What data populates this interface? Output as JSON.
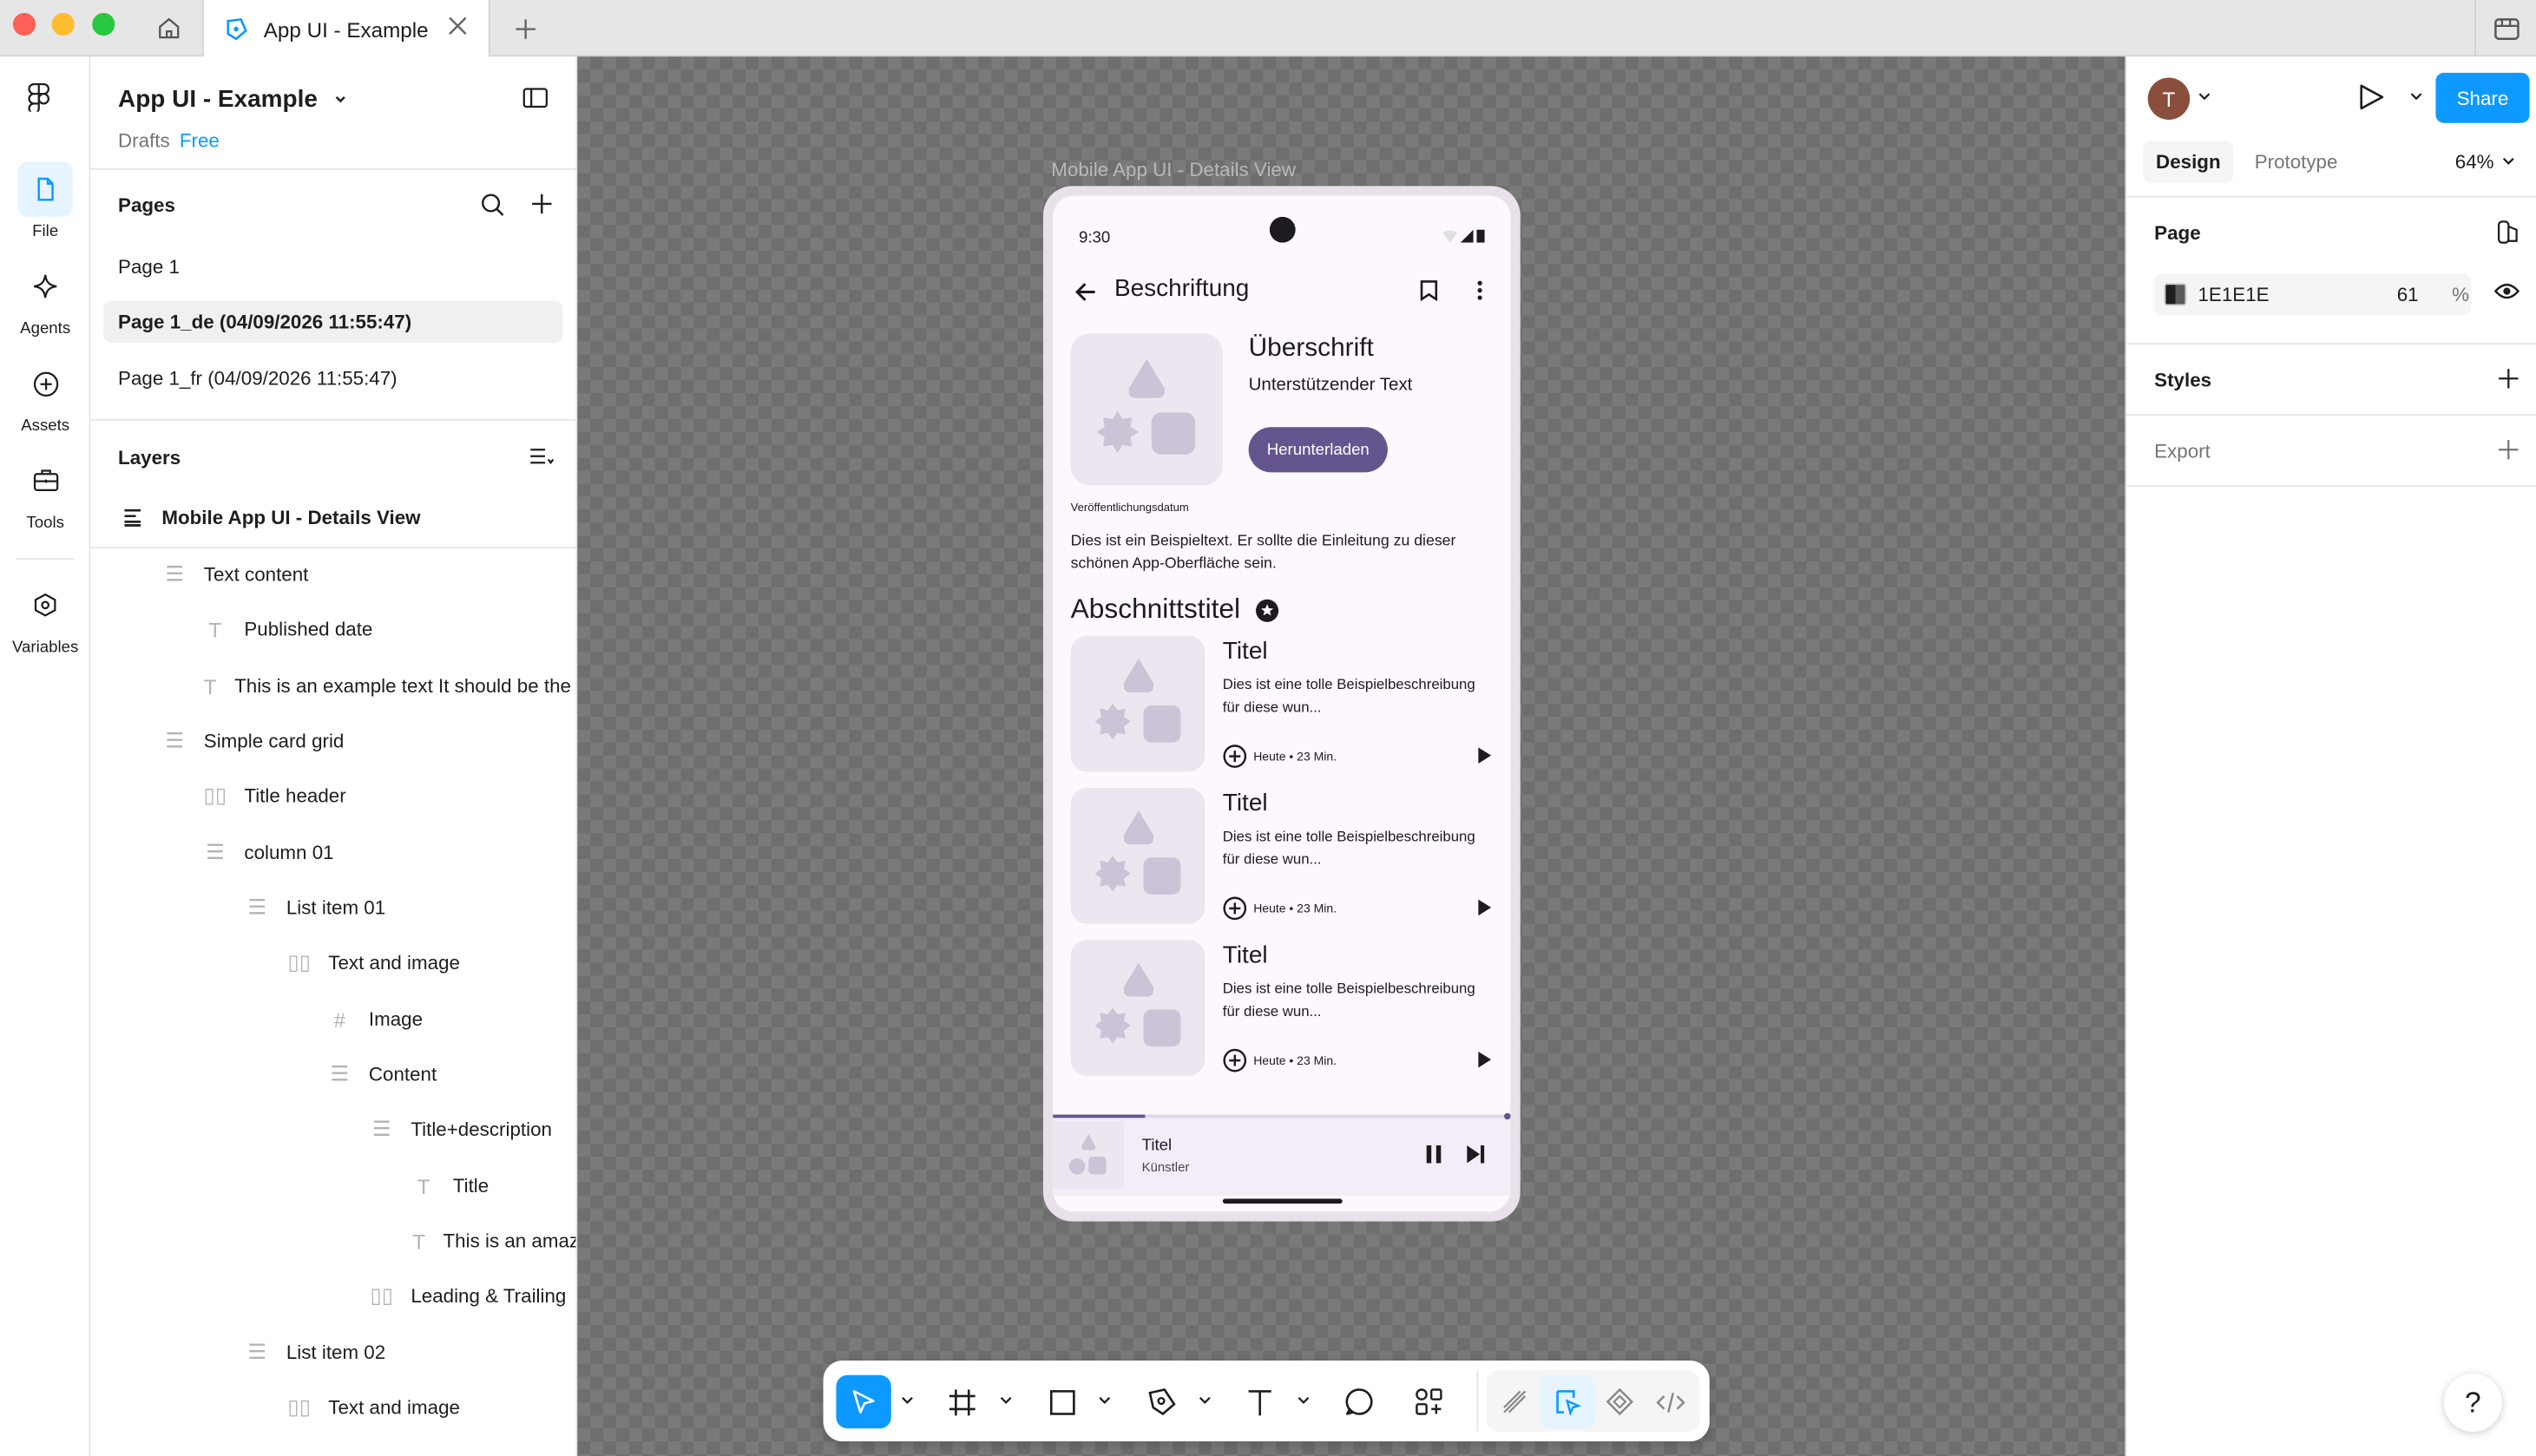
{
  "titlebar": {
    "tab_label": "App UI - Example"
  },
  "rail": {
    "items": [
      {
        "label": "File",
        "icon": "file-icon"
      },
      {
        "label": "Agents",
        "icon": "sparkle-icon"
      },
      {
        "label": "Assets",
        "icon": "plus-circle-icon"
      },
      {
        "label": "Tools",
        "icon": "toolbox-icon"
      },
      {
        "label": "Variables",
        "icon": "hexagon-icon"
      }
    ]
  },
  "left_panel": {
    "file_name": "App UI - Example",
    "breadcrumb_folder": "Drafts",
    "plan": "Free",
    "pages_title": "Pages",
    "pages": [
      {
        "label": "Page 1"
      },
      {
        "label": "Page 1_de (04/09/2026 11:55:47)"
      },
      {
        "label": "Page 1_fr (04/09/2026 11:55:47)"
      }
    ],
    "layers_title": "Layers",
    "layers": [
      {
        "label": "Mobile App UI - Details View",
        "icon": "frame-icon"
      },
      {
        "label": "Text content",
        "icon": "autolayout-icon"
      },
      {
        "label": "Published date",
        "icon": "text-icon"
      },
      {
        "label": "This is an example text It should be the intro",
        "icon": "text-icon"
      },
      {
        "label": "Simple card grid",
        "icon": "autolayout-icon"
      },
      {
        "label": "Title header",
        "icon": "autolayout-horizontal-icon"
      },
      {
        "label": "column 01",
        "icon": "autolayout-icon"
      },
      {
        "label": "List item 01",
        "icon": "autolayout-icon"
      },
      {
        "label": "Text and image",
        "icon": "autolayout-horizontal-icon"
      },
      {
        "label": "Image",
        "icon": "frame-hash-icon"
      },
      {
        "label": "Content",
        "icon": "autolayout-icon"
      },
      {
        "label": "Title+description",
        "icon": "autolayout-icon"
      },
      {
        "label": "Title",
        "icon": "text-icon"
      },
      {
        "label": "This is an amazing description",
        "icon": "text-icon"
      },
      {
        "label": "Leading & Trailing",
        "icon": "autolayout-horizontal-icon"
      },
      {
        "label": "List item 02",
        "icon": "autolayout-icon"
      },
      {
        "label": "Text and image",
        "icon": "autolayout-horizontal-icon"
      }
    ]
  },
  "canvas": {
    "frame_label": "Mobile App UI - Details View",
    "phone": {
      "time": "9:30",
      "appbar_title": "Beschriftung",
      "headline": "Überschrift",
      "supporting_text": "Unterstützender Text",
      "download_button": "Herunterladen",
      "published_label": "Veröffentlichungsdatum",
      "body_text": "Dies ist ein Beispieltext. Er sollte die Einleitung zu dieser schönen App-Oberfläche sein.",
      "section_title": "Abschnittstitel",
      "cards": [
        {
          "title": "Titel",
          "description": "Dies ist eine tolle Beispielbeschreibung für diese wun...",
          "meta": "Heute • 23 Min."
        },
        {
          "title": "Titel",
          "description": "Dies ist eine tolle Beispielbeschreibung für diese wun...",
          "meta": "Heute • 23 Min."
        },
        {
          "title": "Titel",
          "description": "Dies ist eine tolle Beispielbeschreibung für diese wun...",
          "meta": "Heute • 23 Min."
        }
      ],
      "mini_player": {
        "title": "Titel",
        "artist": "Künstler",
        "progress": 0.2
      }
    }
  },
  "toolbar": {
    "tools": [
      "move-tool",
      "frame-tool",
      "rectangle-tool",
      "pen-tool",
      "text-tool",
      "comment-tool",
      "actions-tool"
    ],
    "modes": [
      "draw-mode",
      "design-mode",
      "components-mode",
      "dev-mode"
    ]
  },
  "right_panel": {
    "avatar_initial": "T",
    "share_label": "Share",
    "tabs": {
      "design": "Design",
      "prototype": "Prototype"
    },
    "zoom": "64%",
    "page_section": "Page",
    "page_color_hex": "1E1E1E",
    "page_color_opacity": "61",
    "percent_sign": "%",
    "styles_section": "Styles",
    "export_section": "Export",
    "help_label": "?"
  },
  "colors": {
    "accent": "#0d99ff",
    "brand_purple": "#65558f",
    "canvas_bg": "#1E1E1E"
  }
}
